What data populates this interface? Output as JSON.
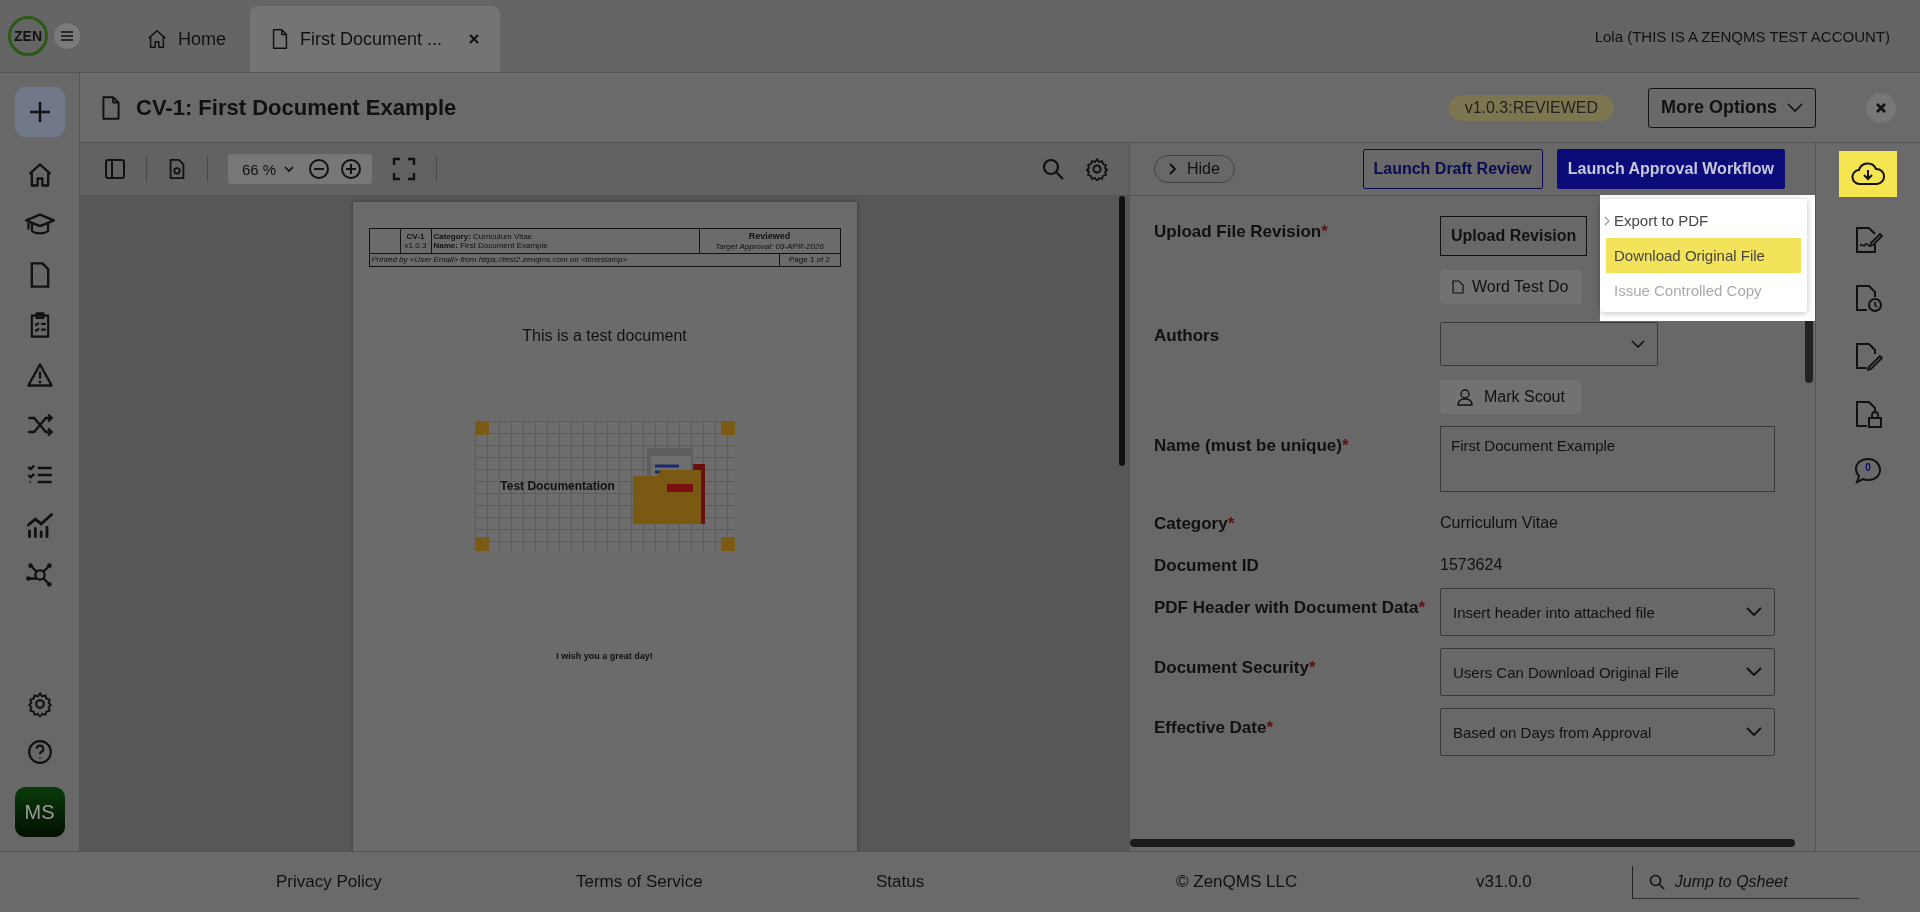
{
  "app": {
    "logo": "ZEN"
  },
  "tabs": [
    {
      "label": "Home",
      "selected": false,
      "closable": false
    },
    {
      "label": "First Document ...",
      "selected": true,
      "closable": true
    }
  ],
  "user": "Lola (THIS IS A ZENQMS TEST ACCOUNT)",
  "sidebar": {
    "avatar": "MS"
  },
  "document": {
    "title": "CV-1: First Document Example",
    "version_badge": "v1.0.3:REVIEWED",
    "more_options": "More Options"
  },
  "viewer": {
    "zoom": "66 %",
    "page": {
      "code": "CV-1",
      "version": "v1.0.3",
      "category_label": "Category:",
      "category": "Curriculum Vitae",
      "name_label": "Name:",
      "name": "First Document Example",
      "status": "Reviewed",
      "target": "Target Approval: 09-APR-2026",
      "printed": "Printed by <User Email> from https://test2.zenqms.com on <timestamp>",
      "page_no": "Page 1 of 2",
      "heading": "This is a test document",
      "image_text": "Test Documentation",
      "closing": "I wish you a great day!"
    }
  },
  "panel": {
    "hide": "Hide",
    "buttons": [
      {
        "label": "Launch Draft Review",
        "kind": "outline"
      },
      {
        "label": "Launch Approval Workflow",
        "kind": "primary"
      }
    ],
    "fields": [
      {
        "label": "Upload File Revision",
        "required_mark": "*",
        "kind": "upload",
        "button": "Upload Revision",
        "file": "Word Test Do"
      },
      {
        "label": "Authors",
        "kind": "multiselect",
        "chips": [
          "Mark Scout"
        ]
      },
      {
        "label": "Name (must be unique)",
        "required_mark": "*",
        "kind": "textarea",
        "value": "First Document Example"
      },
      {
        "label": "Category",
        "required_mark": "*",
        "kind": "text",
        "value": "Curriculum Vitae"
      },
      {
        "label": "Document ID",
        "kind": "text",
        "value": "1573624"
      },
      {
        "label": "PDF Header with Document Data",
        "required_mark": "*",
        "kind": "select",
        "value": "Insert header into attached file"
      },
      {
        "label": "Document Security",
        "required_mark": "*",
        "kind": "select",
        "value": "Users Can Download Original File"
      },
      {
        "label": "Effective Date",
        "required_mark": "*",
        "kind": "select",
        "value": "Based on Days from Approval"
      }
    ]
  },
  "menu": {
    "items": [
      {
        "label": "Export to PDF",
        "submenu": true,
        "selected": false,
        "disabled": false
      },
      {
        "label": "Download Original File",
        "submenu": false,
        "selected": true,
        "disabled": false
      },
      {
        "label": "Issue Controlled Copy",
        "submenu": false,
        "selected": false,
        "disabled": true
      }
    ]
  },
  "actions": {
    "download_highlighted": true,
    "comment_count": "0"
  },
  "footer": {
    "links": [
      "Privacy Policy",
      "Terms of Service",
      "Status"
    ],
    "copyright": "© ZenQMS LLC",
    "version": "v31.0.0",
    "search": {
      "placeholder": "Jump to Qsheet"
    }
  }
}
